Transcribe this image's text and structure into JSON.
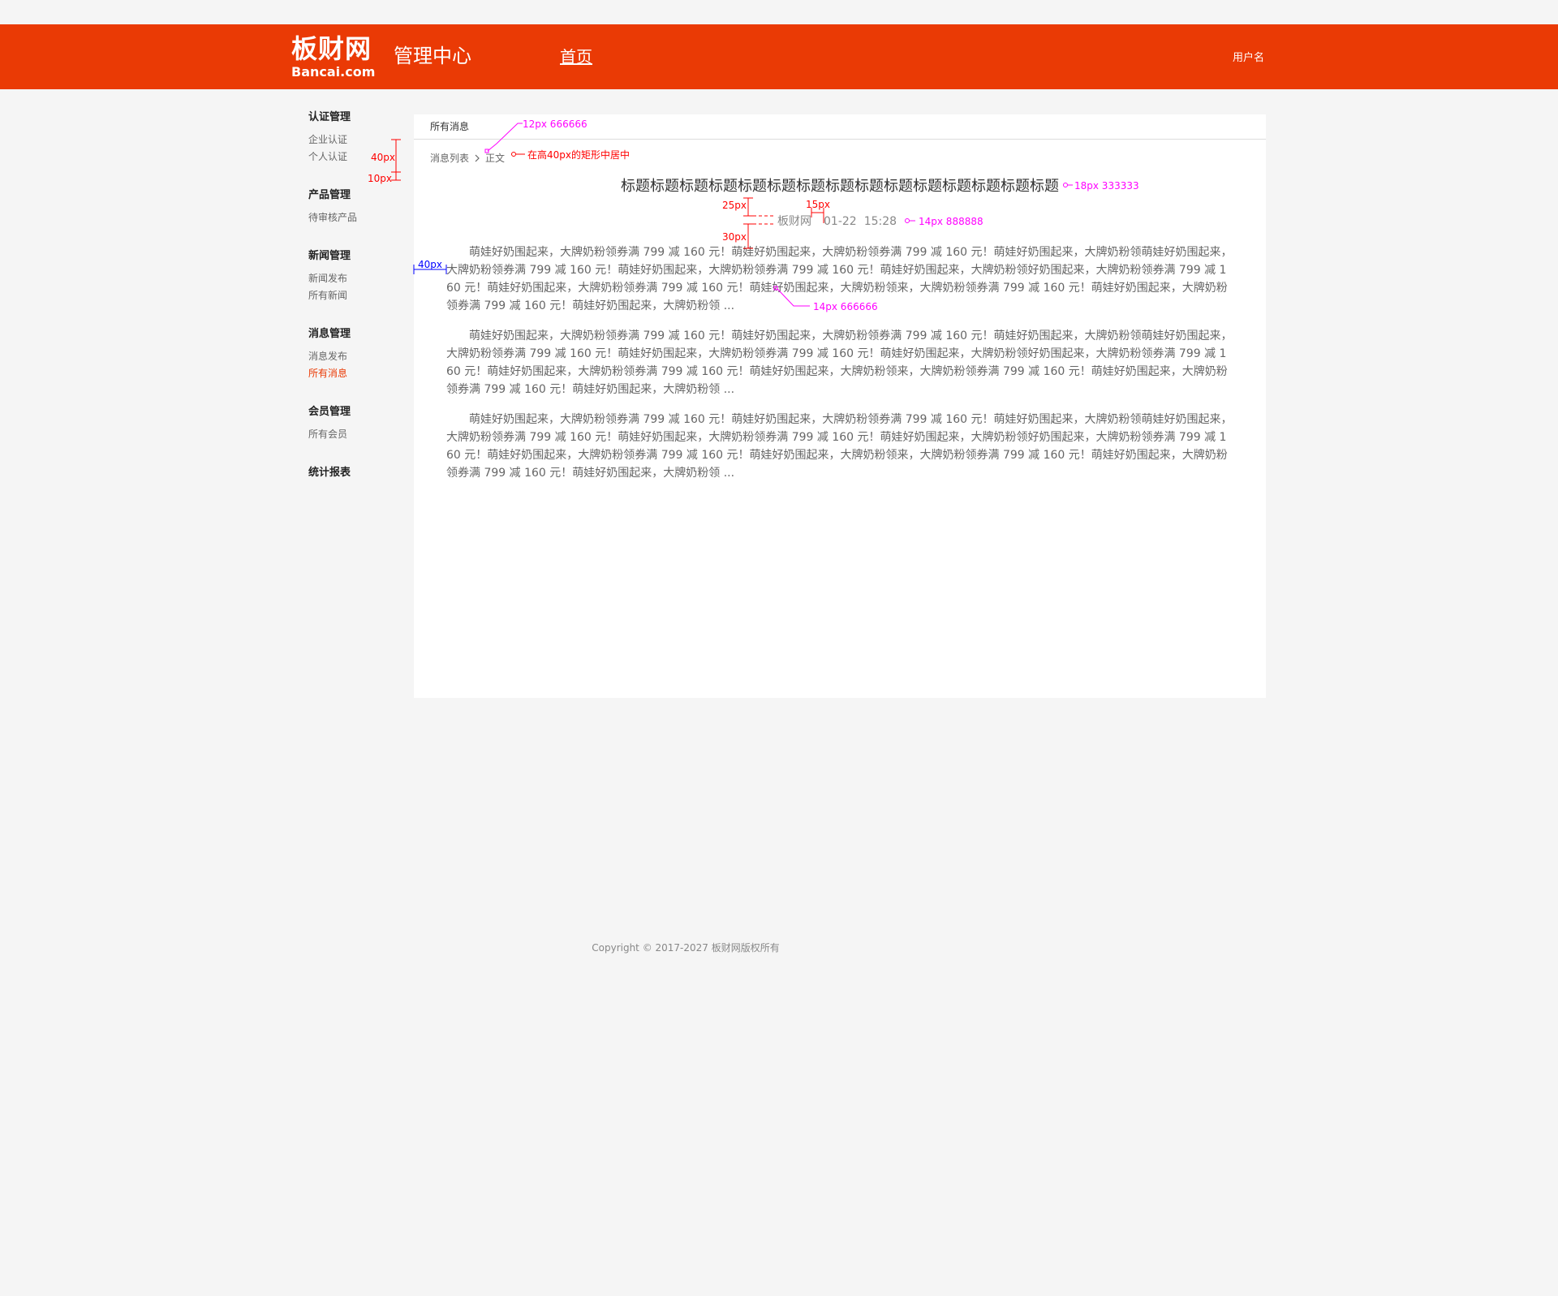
{
  "header": {
    "logo_cn": "板财网",
    "logo_en": "Bancai.com",
    "app_title": "管理中心",
    "nav_home": "首页",
    "username": "用户名",
    "bg_color": "#ea3a05"
  },
  "sidebar": {
    "groups": [
      {
        "title": "认证管理",
        "items": [
          "企业认证",
          "个人认证"
        ]
      },
      {
        "title": "产品管理",
        "items": [
          "待审核产品"
        ]
      },
      {
        "title": "新闻管理",
        "items": [
          "新闻发布",
          "所有新闻"
        ]
      },
      {
        "title": "消息管理",
        "items": [
          "消息发布",
          "所有消息"
        ]
      },
      {
        "title": "会员管理",
        "items": [
          "所有会员"
        ]
      },
      {
        "title": "统计报表",
        "items": []
      }
    ],
    "active_item": "所有消息",
    "active_color": "#ea3a05"
  },
  "main": {
    "tab": "所有消息",
    "breadcrumb": {
      "parent": "消息列表",
      "current": "正文",
      "separator_icon": "chevron-right-icon"
    },
    "article": {
      "title": "标题标题标题标题标题标题标题标题标题标题标题标题标题标题标题",
      "source": "板财网",
      "date": "01-22",
      "time": "15:28",
      "paragraphs": [
        "萌娃好奶围起来，大牌奶粉领券满 799 减 160 元！萌娃好奶围起来，大牌奶粉领券满 799 减 160 元！萌娃好奶围起来，大牌奶粉领萌娃好奶围起来，大牌奶粉领券满 799 减 160 元！萌娃好奶围起来，大牌奶粉领券满 799 减 160 元！萌娃好奶围起来，大牌奶粉领好奶围起来，大牌奶粉领券满 799 减 160 元！萌娃好奶围起来，大牌奶粉领券满 799 减 160 元！萌娃好奶围起来，大牌奶粉领来，大牌奶粉领券满 799 减 160 元！萌娃好奶围起来，大牌奶粉领券满 799 减 160 元！萌娃好奶围起来，大牌奶粉领 ...",
        "萌娃好奶围起来，大牌奶粉领券满 799 减 160 元！萌娃好奶围起来，大牌奶粉领券满 799 减 160 元！萌娃好奶围起来，大牌奶粉领萌娃好奶围起来，大牌奶粉领券满 799 减 160 元！萌娃好奶围起来，大牌奶粉领券满 799 减 160 元！萌娃好奶围起来，大牌奶粉领好奶围起来，大牌奶粉领券满 799 减 160 元！萌娃好奶围起来，大牌奶粉领券满 799 减 160 元！萌娃好奶围起来，大牌奶粉领来，大牌奶粉领券满 799 减 160 元！萌娃好奶围起来，大牌奶粉领券满 799 减 160 元！萌娃好奶围起来，大牌奶粉领 ...",
        "萌娃好奶围起来，大牌奶粉领券满 799 减 160 元！萌娃好奶围起来，大牌奶粉领券满 799 减 160 元！萌娃好奶围起来，大牌奶粉领萌娃好奶围起来，大牌奶粉领券满 799 减 160 元！萌娃好奶围起来，大牌奶粉领券满 799 减 160 元！萌娃好奶围起来，大牌奶粉领好奶围起来，大牌奶粉领券满 799 减 160 元！萌娃好奶围起来，大牌奶粉领券满 799 减 160 元！萌娃好奶围起来，大牌奶粉领来，大牌奶粉领券满 799 减 160 元！萌娃好奶围起来，大牌奶粉领券满 799 减 160 元！萌娃好奶围起来，大牌奶粉领 ..."
      ]
    }
  },
  "annotations": {
    "tab_font": "12px 666666",
    "breadcrumb_note": "在高40px的矩形中居中",
    "title_font": "18px 333333",
    "meta_font": "14px 888888",
    "body_font": "14px 666666",
    "gap_25": "25px",
    "gap_15": "15px",
    "gap_30": "30px",
    "sidebar_40": "40px",
    "sidebar_10": "10px",
    "indent_40": "40px",
    "colors": {
      "pink": "#ff00ff",
      "red": "#ff0000",
      "blue": "#0000ff"
    }
  },
  "footer": {
    "copyright": "Copyright © 2017-2027  板财网版权所有"
  }
}
